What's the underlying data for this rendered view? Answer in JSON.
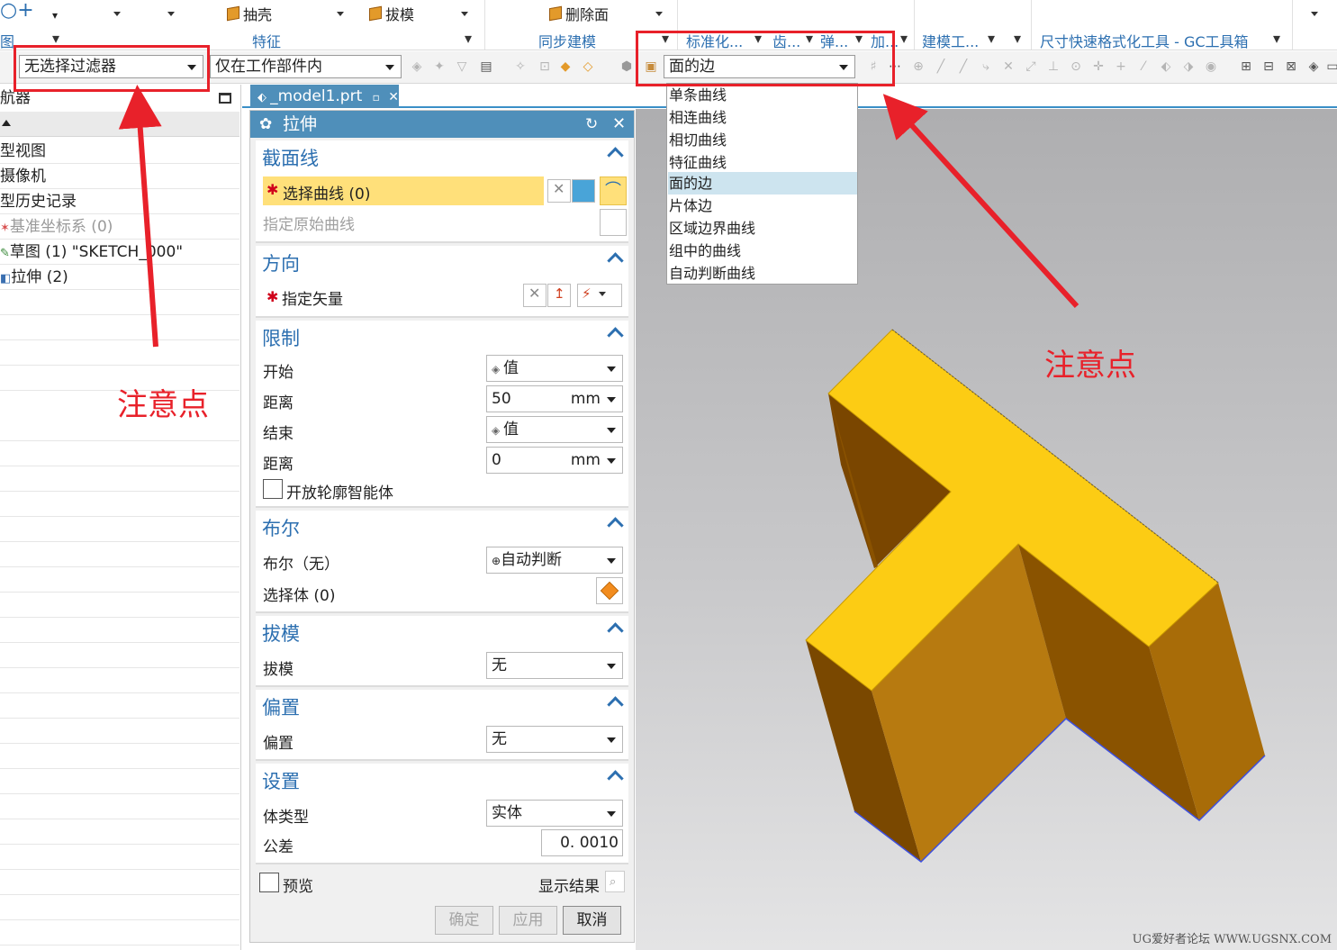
{
  "ribbon": {
    "items": [
      "抽壳",
      "拔模",
      "删除面"
    ],
    "groups": [
      "图",
      "特征",
      "同步建模",
      "标准化...",
      "齿...",
      "弹...",
      "加...",
      "建模工...",
      "尺寸快速格式化工具 - GC工具箱"
    ]
  },
  "selection_toolbar": {
    "filter_value": "无选择过滤器",
    "scope_value": "仅在工作部件内",
    "curve_rule_value": "面的边"
  },
  "curve_rule_options": [
    "单条曲线",
    "相连曲线",
    "相切曲线",
    "特征曲线",
    "面的边",
    "片体边",
    "区域边界曲线",
    "组中的曲线",
    "自动判断曲线"
  ],
  "navigator": {
    "title": "航器",
    "rows": [
      "型视图",
      "摄像机",
      "型历史记录",
      "基准坐标系 (0)",
      "草图 (1) \"SKETCH_000\"",
      "拉伸 (2)"
    ]
  },
  "tab": {
    "label": "_model1.prt"
  },
  "dialog": {
    "title": "拉伸",
    "sections": {
      "section_curve": {
        "title": "截面线",
        "select_curve": "选择曲线 (0)",
        "specify_origin": "指定原始曲线"
      },
      "direction": {
        "title": "方向",
        "specify_vector": "指定矢量"
      },
      "limits": {
        "title": "限制",
        "start_label": "开始",
        "start_value": "值",
        "distance1_label": "距离",
        "distance1_value": "50",
        "distance1_unit": "mm",
        "end_label": "结束",
        "end_value": "值",
        "distance2_label": "距离",
        "distance2_value": "0",
        "distance2_unit": "mm",
        "open_profile": "开放轮廓智能体"
      },
      "boolean": {
        "title": "布尔",
        "bool_label": "布尔（无）",
        "bool_value": "自动判断",
        "select_body": "选择体 (0)"
      },
      "draft": {
        "title": "拔模",
        "label": "拔模",
        "value": "无"
      },
      "offset": {
        "title": "偏置",
        "label": "偏置",
        "value": "无"
      },
      "settings": {
        "title": "设置",
        "body_type_label": "体类型",
        "body_type_value": "实体",
        "tolerance_label": "公差",
        "tolerance_value": "0. 0010"
      }
    },
    "preview_label": "预览",
    "show_result": "显示结果",
    "buttons": {
      "ok": "确定",
      "apply": "应用",
      "cancel": "取消"
    }
  },
  "annotations": {
    "left": "注意点",
    "right": "注意点"
  },
  "watermark": "UG爱好者论坛 WWW.UGSNX.COM",
  "colors": {
    "accent": "#4f8fba",
    "section_title": "#2c6fb0",
    "highlight": "#ffe07a",
    "annotation": "#e8212a",
    "model_top": "#fccc14",
    "model_side": "#b87a0a"
  }
}
